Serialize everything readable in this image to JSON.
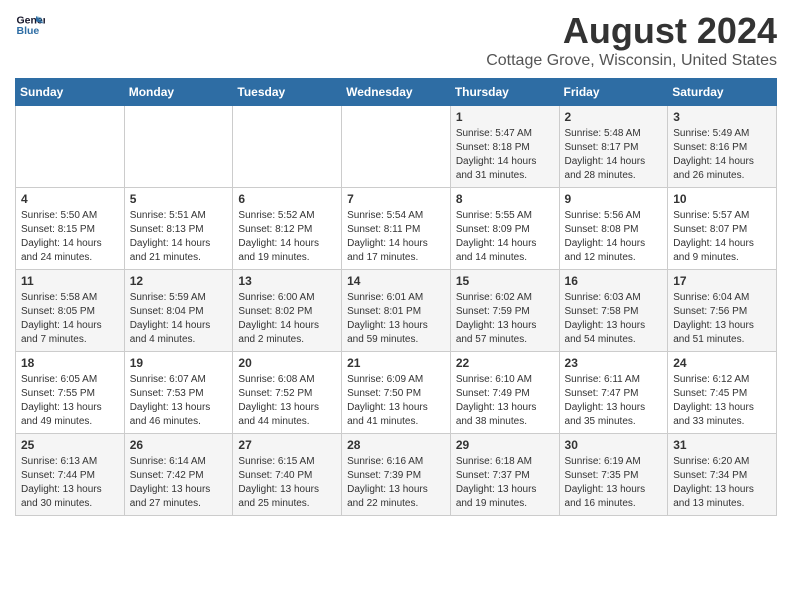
{
  "logo": {
    "line1": "General",
    "line2": "Blue"
  },
  "title": "August 2024",
  "subtitle": "Cottage Grove, Wisconsin, United States",
  "days_of_week": [
    "Sunday",
    "Monday",
    "Tuesday",
    "Wednesday",
    "Thursday",
    "Friday",
    "Saturday"
  ],
  "weeks": [
    [
      {
        "num": "",
        "info": ""
      },
      {
        "num": "",
        "info": ""
      },
      {
        "num": "",
        "info": ""
      },
      {
        "num": "",
        "info": ""
      },
      {
        "num": "1",
        "info": "Sunrise: 5:47 AM\nSunset: 8:18 PM\nDaylight: 14 hours\nand 31 minutes."
      },
      {
        "num": "2",
        "info": "Sunrise: 5:48 AM\nSunset: 8:17 PM\nDaylight: 14 hours\nand 28 minutes."
      },
      {
        "num": "3",
        "info": "Sunrise: 5:49 AM\nSunset: 8:16 PM\nDaylight: 14 hours\nand 26 minutes."
      }
    ],
    [
      {
        "num": "4",
        "info": "Sunrise: 5:50 AM\nSunset: 8:15 PM\nDaylight: 14 hours\nand 24 minutes."
      },
      {
        "num": "5",
        "info": "Sunrise: 5:51 AM\nSunset: 8:13 PM\nDaylight: 14 hours\nand 21 minutes."
      },
      {
        "num": "6",
        "info": "Sunrise: 5:52 AM\nSunset: 8:12 PM\nDaylight: 14 hours\nand 19 minutes."
      },
      {
        "num": "7",
        "info": "Sunrise: 5:54 AM\nSunset: 8:11 PM\nDaylight: 14 hours\nand 17 minutes."
      },
      {
        "num": "8",
        "info": "Sunrise: 5:55 AM\nSunset: 8:09 PM\nDaylight: 14 hours\nand 14 minutes."
      },
      {
        "num": "9",
        "info": "Sunrise: 5:56 AM\nSunset: 8:08 PM\nDaylight: 14 hours\nand 12 minutes."
      },
      {
        "num": "10",
        "info": "Sunrise: 5:57 AM\nSunset: 8:07 PM\nDaylight: 14 hours\nand 9 minutes."
      }
    ],
    [
      {
        "num": "11",
        "info": "Sunrise: 5:58 AM\nSunset: 8:05 PM\nDaylight: 14 hours\nand 7 minutes."
      },
      {
        "num": "12",
        "info": "Sunrise: 5:59 AM\nSunset: 8:04 PM\nDaylight: 14 hours\nand 4 minutes."
      },
      {
        "num": "13",
        "info": "Sunrise: 6:00 AM\nSunset: 8:02 PM\nDaylight: 14 hours\nand 2 minutes."
      },
      {
        "num": "14",
        "info": "Sunrise: 6:01 AM\nSunset: 8:01 PM\nDaylight: 13 hours\nand 59 minutes."
      },
      {
        "num": "15",
        "info": "Sunrise: 6:02 AM\nSunset: 7:59 PM\nDaylight: 13 hours\nand 57 minutes."
      },
      {
        "num": "16",
        "info": "Sunrise: 6:03 AM\nSunset: 7:58 PM\nDaylight: 13 hours\nand 54 minutes."
      },
      {
        "num": "17",
        "info": "Sunrise: 6:04 AM\nSunset: 7:56 PM\nDaylight: 13 hours\nand 51 minutes."
      }
    ],
    [
      {
        "num": "18",
        "info": "Sunrise: 6:05 AM\nSunset: 7:55 PM\nDaylight: 13 hours\nand 49 minutes."
      },
      {
        "num": "19",
        "info": "Sunrise: 6:07 AM\nSunset: 7:53 PM\nDaylight: 13 hours\nand 46 minutes."
      },
      {
        "num": "20",
        "info": "Sunrise: 6:08 AM\nSunset: 7:52 PM\nDaylight: 13 hours\nand 44 minutes."
      },
      {
        "num": "21",
        "info": "Sunrise: 6:09 AM\nSunset: 7:50 PM\nDaylight: 13 hours\nand 41 minutes."
      },
      {
        "num": "22",
        "info": "Sunrise: 6:10 AM\nSunset: 7:49 PM\nDaylight: 13 hours\nand 38 minutes."
      },
      {
        "num": "23",
        "info": "Sunrise: 6:11 AM\nSunset: 7:47 PM\nDaylight: 13 hours\nand 35 minutes."
      },
      {
        "num": "24",
        "info": "Sunrise: 6:12 AM\nSunset: 7:45 PM\nDaylight: 13 hours\nand 33 minutes."
      }
    ],
    [
      {
        "num": "25",
        "info": "Sunrise: 6:13 AM\nSunset: 7:44 PM\nDaylight: 13 hours\nand 30 minutes."
      },
      {
        "num": "26",
        "info": "Sunrise: 6:14 AM\nSunset: 7:42 PM\nDaylight: 13 hours\nand 27 minutes."
      },
      {
        "num": "27",
        "info": "Sunrise: 6:15 AM\nSunset: 7:40 PM\nDaylight: 13 hours\nand 25 minutes."
      },
      {
        "num": "28",
        "info": "Sunrise: 6:16 AM\nSunset: 7:39 PM\nDaylight: 13 hours\nand 22 minutes."
      },
      {
        "num": "29",
        "info": "Sunrise: 6:18 AM\nSunset: 7:37 PM\nDaylight: 13 hours\nand 19 minutes."
      },
      {
        "num": "30",
        "info": "Sunrise: 6:19 AM\nSunset: 7:35 PM\nDaylight: 13 hours\nand 16 minutes."
      },
      {
        "num": "31",
        "info": "Sunrise: 6:20 AM\nSunset: 7:34 PM\nDaylight: 13 hours\nand 13 minutes."
      }
    ]
  ]
}
